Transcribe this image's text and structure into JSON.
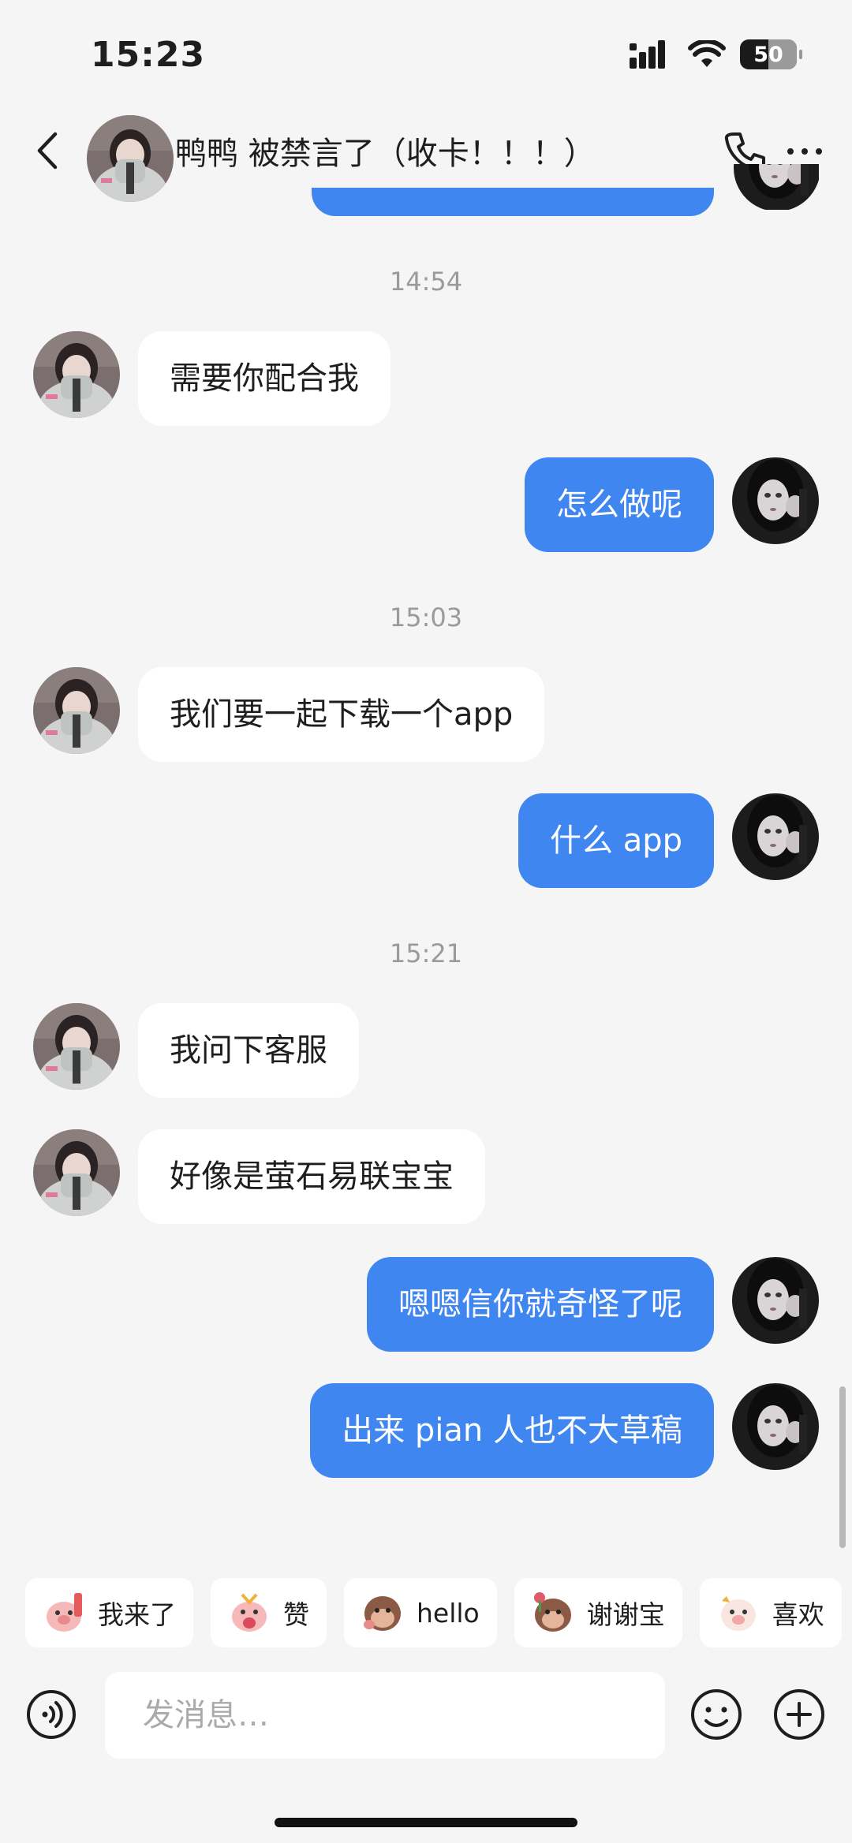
{
  "status_bar": {
    "time": "15:23",
    "battery": "50"
  },
  "header": {
    "contact_name": "鸭鸭 被禁言了（收卡！！！）",
    "avatar_icon": "contact-avatar",
    "call_icon": "phone-icon",
    "more_icon": "more-icon"
  },
  "chat": {
    "timestamps": [
      "14:54",
      "15:03",
      "15:21"
    ],
    "messages": [
      {
        "direction": "incoming",
        "text": "需要你配合我"
      },
      {
        "direction": "outgoing",
        "text": "怎么做呢"
      },
      {
        "direction": "incoming",
        "text": "我们要一起下载一个app"
      },
      {
        "direction": "outgoing",
        "text": "什么 app"
      },
      {
        "direction": "incoming",
        "text": "我问下客服"
      },
      {
        "direction": "incoming",
        "text": "好像是萤石易联宝宝"
      },
      {
        "direction": "outgoing",
        "text": "嗯嗯信你就奇怪了呢"
      },
      {
        "direction": "outgoing",
        "text": "出来 pian 人也不大草稿"
      }
    ]
  },
  "quick_replies": [
    "我来了",
    "赞",
    "hello",
    "谢谢宝",
    "喜欢"
  ],
  "composer": {
    "placeholder": "发消息…"
  },
  "colors": {
    "outgoing_bubble": "#3f86f0",
    "incoming_bubble": "#ffffff",
    "background": "#f5f5f5"
  }
}
